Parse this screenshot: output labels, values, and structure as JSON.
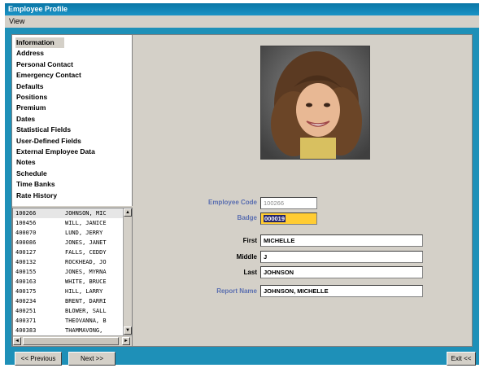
{
  "window": {
    "title": "Employee Profile"
  },
  "menu": {
    "view": "View"
  },
  "nav": {
    "items": [
      "Information",
      "Address",
      "Personal Contact",
      "Emergency Contact",
      "Defaults",
      "Positions",
      "Premium",
      "Dates",
      "Statistical Fields",
      "User-Defined Fields",
      "External Employee Data",
      "Notes",
      "Schedule",
      "Time Banks",
      "Rate History"
    ],
    "selected": "Information"
  },
  "employees": [
    {
      "code": "100266",
      "name": "JOHNSON, MIC"
    },
    {
      "code": "100456",
      "name": "WILL, JANICE"
    },
    {
      "code": "400070",
      "name": "LUND, JERRY"
    },
    {
      "code": "400086",
      "name": "JONES, JANET"
    },
    {
      "code": "400127",
      "name": "FALLS, CEDDY"
    },
    {
      "code": "400132",
      "name": "ROCKHEAD, JO"
    },
    {
      "code": "400155",
      "name": "JONES, MYRNA"
    },
    {
      "code": "400163",
      "name": "WHITE, BRUCE"
    },
    {
      "code": "400175",
      "name": "HILL, LARRY"
    },
    {
      "code": "400234",
      "name": "BRENT, DARRI"
    },
    {
      "code": "400251",
      "name": "BLOWER, SALL"
    },
    {
      "code": "400371",
      "name": "THEOVANNA, B"
    },
    {
      "code": "400383",
      "name": "THAMMAVONG, "
    }
  ],
  "scrollbar": {
    "up": "▲",
    "down": "▼",
    "left": "◄",
    "right": "►"
  },
  "form": {
    "employee_code_label": "Employee Code",
    "employee_code": "100266",
    "badge_label": "Badge",
    "badge": "000019",
    "first_label": "First",
    "first": "MICHELLE",
    "middle_label": "Middle",
    "middle": "J",
    "last_label": "Last",
    "last": "JOHNSON",
    "report_name_label": "Report Name",
    "report_name": "JOHNSON, MICHELLE"
  },
  "buttons": {
    "previous": "<< Previous",
    "next": "Next >>",
    "exit": "Exit <<"
  },
  "colors": {
    "frame": "#1e90b8",
    "title": "#0a76a6",
    "panel": "#d4d0c8",
    "badge_field": "#ffcc33",
    "label_blue": "#5b6fb0"
  }
}
